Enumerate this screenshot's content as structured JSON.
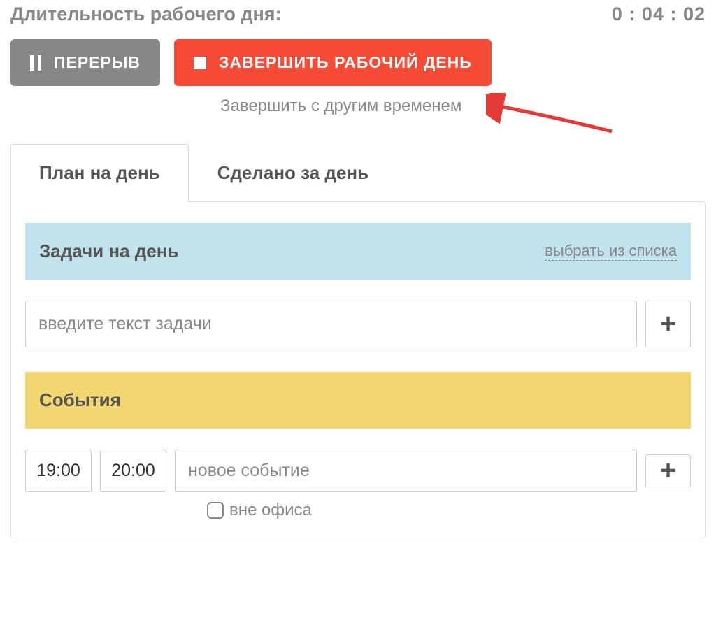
{
  "header": {
    "duration_label": "Длительность рабочего дня:",
    "timer": "0 : 04 : 02"
  },
  "buttons": {
    "pause_label": "ПЕРЕРЫВ",
    "stop_label": "ЗАВЕРШИТЬ РАБОЧИЙ ДЕНЬ"
  },
  "finish_other": "Завершить с другим временем",
  "tabs": {
    "plan": "План на день",
    "done": "Сделано за день"
  },
  "tasks": {
    "title": "Задачи на день",
    "choose_link": "выбрать из списка",
    "input_placeholder": "введите текст задачи",
    "add_label": "+"
  },
  "events": {
    "title": "События",
    "time_from": "19:00",
    "time_to": "20:00",
    "event_placeholder": "новое событие",
    "add_label": "+",
    "out_of_office": "вне офиса"
  }
}
